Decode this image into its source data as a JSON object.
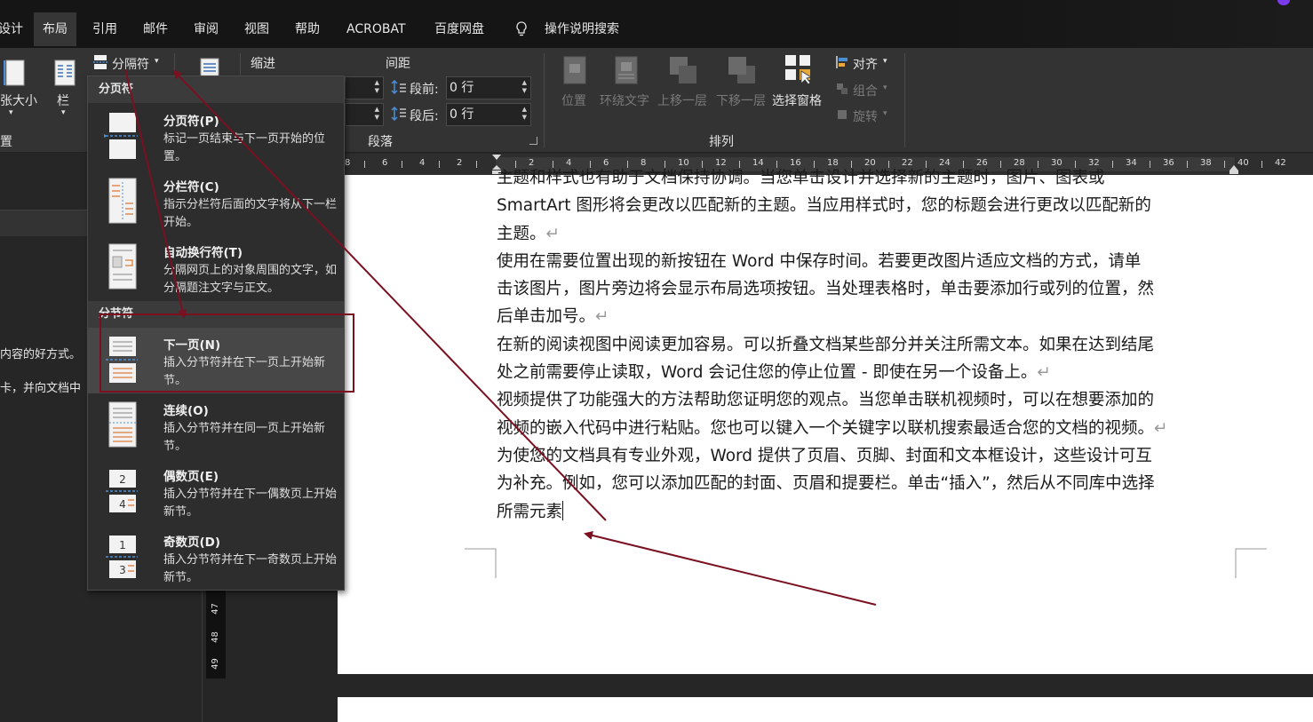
{
  "tabs": [
    {
      "label": "设计"
    },
    {
      "label": "布局"
    },
    {
      "label": "引用"
    },
    {
      "label": "邮件"
    },
    {
      "label": "审阅"
    },
    {
      "label": "视图"
    },
    {
      "label": "帮助"
    },
    {
      "label": "ACROBAT"
    },
    {
      "label": "百度网盘"
    }
  ],
  "tell_me": "操作说明搜索",
  "ribbon": {
    "size_label": "张大小",
    "columns_label": "栏",
    "setup_group_label": "置",
    "breaks_button": "分隔符",
    "indent_label": "缩进",
    "spacing_label": "间距",
    "before_label": "段前:",
    "before_value": "0 行",
    "after_label": "段后:",
    "after_value": "0 行",
    "paragraph_group_label": "段落",
    "arrange": {
      "position": "位置",
      "wrap_text": "环绕文字",
      "bring_forward": "上移一层",
      "send_backward": "下移一层",
      "selection_pane": "选择窗格",
      "align": "对齐",
      "group": "组合",
      "rotate": "旋转",
      "group_label": "排列"
    }
  },
  "ruler": {
    "left_ticks": [
      "8",
      "6",
      "4",
      "2"
    ],
    "right_ticks": [
      "2",
      "4",
      "6",
      "8",
      "10",
      "12",
      "14",
      "16",
      "18",
      "20",
      "22",
      "24",
      "26",
      "28",
      "30",
      "32",
      "34",
      "36",
      "38",
      "40",
      "42"
    ]
  },
  "vertical_ruler": [
    "47",
    "48",
    "49"
  ],
  "left_panel": {
    "line1": "内容的好方式。",
    "line2": "卡，并向文档中"
  },
  "breaks_menu": {
    "page_breaks_header": "分页符",
    "section_breaks_header": "分节符",
    "items": [
      {
        "title": "分页符(P)",
        "desc": "标记一页结束与下一页开始的位置。"
      },
      {
        "title": "分栏符(C)",
        "desc": "指示分栏符后面的文字将从下一栏开始。"
      },
      {
        "title": "自动换行符(T)",
        "desc": "分隔网页上的对象周围的文字，如分隔题注文字与正文。"
      },
      {
        "title": "下一页(N)",
        "desc": "插入分节符并在下一页上开始新节。"
      },
      {
        "title": "连续(O)",
        "desc": "插入分节符并在同一页上开始新节。"
      },
      {
        "title": "偶数页(E)",
        "desc": "插入分节符并在下一偶数页上开始新节。"
      },
      {
        "title": "奇数页(D)",
        "desc": "插入分节符并在下一奇数页上开始新节。"
      }
    ]
  },
  "document": {
    "lines": [
      {
        "text": "主题和样式也有助于文档保持协调。当您单击设计并选择新的主题时，图片、图表或",
        "mark": ""
      },
      {
        "text": "SmartArt 图形将会更改以匹配新的主题。当应用样式时，您的标题会进行更改以匹配新的",
        "mark": ""
      },
      {
        "text": "主题。",
        "mark": "↵"
      },
      {
        "text": "使用在需要位置出现的新按钮在 Word 中保存时间。若要更改图片适应文档的方式，请单",
        "mark": ""
      },
      {
        "text": "击该图片，图片旁边将会显示布局选项按钮。当处理表格时，单击要添加行或列的位置，然",
        "mark": ""
      },
      {
        "text": "后单击加号。",
        "mark": "↵"
      },
      {
        "text": "在新的阅读视图中阅读更加容易。可以折叠文档某些部分并关注所需文本。如果在达到结尾",
        "mark": ""
      },
      {
        "text": "处之前需要停止读取，Word 会记住您的停止位置 - 即使在另一个设备上。",
        "mark": "↵"
      },
      {
        "text": "视频提供了功能强大的方法帮助您证明您的观点。当您单击联机视频时，可以在想要添加的",
        "mark": ""
      },
      {
        "text": "视频的嵌入代码中进行粘贴。您也可以键入一个关键字以联机搜索最适合您的文档的视频。",
        "mark": "↵"
      },
      {
        "text": "为使您的文档具有专业外观，Word 提供了页眉、页脚、封面和文本框设计，这些设计可互",
        "mark": ""
      },
      {
        "text": "为补充。例如，您可以添加匹配的封面、页眉和提要栏。单击“插入”，然后从不同库中选择",
        "mark": ""
      },
      {
        "text": "所需元素",
        "mark": ""
      }
    ]
  },
  "colors": {
    "annotation": "#7a1020",
    "menu_bg": "#2d2d2d",
    "menu_highlight": "#474747",
    "accent_orange": "#e07b39"
  }
}
